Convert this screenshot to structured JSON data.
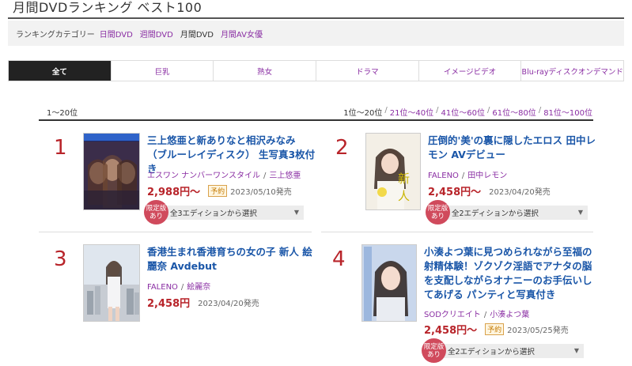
{
  "page": {
    "title": "月間DVDランキング ベスト100"
  },
  "category_bar": {
    "label": "ランキングカテゴリー",
    "links": [
      {
        "label": "日間DVD",
        "active": false
      },
      {
        "label": "週間DVD",
        "active": false
      },
      {
        "label": "月間DVD",
        "active": true
      },
      {
        "label": "月間AV女優",
        "active": false
      }
    ]
  },
  "genre_tabs": [
    {
      "label": "全て",
      "active": true
    },
    {
      "label": "巨乳",
      "active": false
    },
    {
      "label": "熟女",
      "active": false
    },
    {
      "label": "ドラマ",
      "active": false
    },
    {
      "label": "イメージビデオ",
      "active": false
    },
    {
      "label": "Blu-rayディスクオンデマンド",
      "active": false
    }
  ],
  "range": {
    "current": "1〜20位",
    "links": [
      "1位〜20位",
      "21位〜40位",
      "41位〜60位",
      "61位〜80位",
      "81位〜100位"
    ],
    "separator": "/"
  },
  "items": [
    {
      "rank": "1",
      "title": "三上悠亜と新ありなと相沢みなみ （ブルーレイディスク） 生写真3枚付き",
      "maker": "エスワン ナンバーワンスタイル",
      "actress": "三上悠亜",
      "price": "2,988円〜",
      "preorder": "予約",
      "date": "2023/05/10発売",
      "badge": [
        "限定版",
        "あり"
      ],
      "edition": "全3エディションから選択"
    },
    {
      "rank": "2",
      "title": "圧倒的'美'の裏に隠したエロス 田中レモン AVデビュー",
      "maker": "FALENO",
      "actress": "田中レモン",
      "price": "2,458円〜",
      "preorder": "",
      "date": "2023/04/20発売",
      "badge": [
        "限定版",
        "あり"
      ],
      "edition": "全2エディションから選択"
    },
    {
      "rank": "3",
      "title": "香港生まれ香港育ちの女の子 新人 絵麗奈 Avdebut",
      "maker": "FALENO",
      "actress": "絵麗奈",
      "price": "2,458円",
      "preorder": "",
      "date": "2023/04/20発売",
      "badge": [],
      "edition": ""
    },
    {
      "rank": "4",
      "title": "小湊よつ葉に見つめられながら至福の射精体験！ゾクゾク淫語でアナタの脳を支配しながらオナニーのお手伝いしてあげる パンティと写真付き",
      "maker": "SODクリエイト",
      "actress": "小湊よつ葉",
      "price": "2,458円〜",
      "preorder": "予約",
      "date": "2023/05/25発売",
      "badge": [
        "限定版",
        "あり"
      ],
      "edition": "全2エディションから選択"
    }
  ],
  "colors": {
    "accent_purple": "#8a2ea3",
    "rank_red": "#b8242a",
    "title_blue": "#1a56a8",
    "badge_pink": "#d04a5c"
  }
}
